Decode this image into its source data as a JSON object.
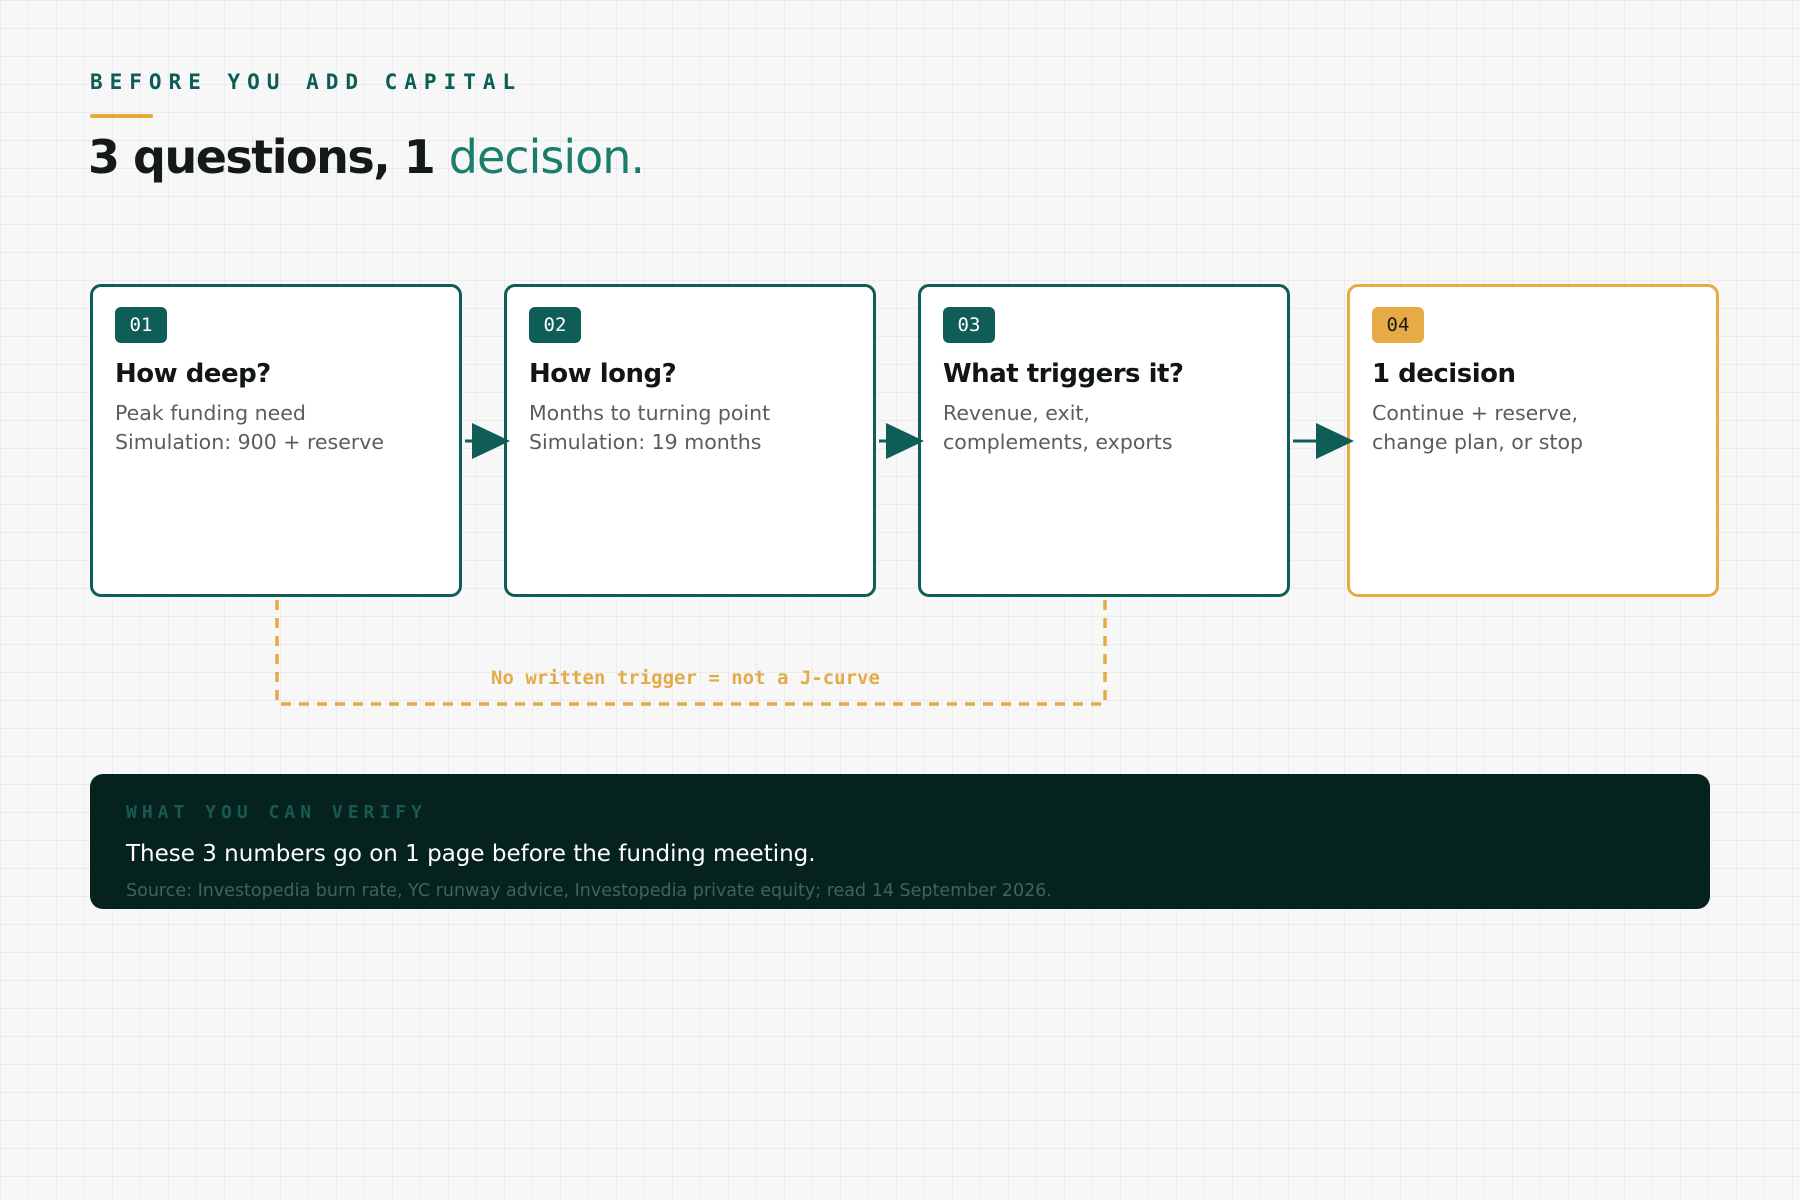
{
  "header": {
    "eyebrow": "BEFORE YOU ADD CAPITAL",
    "title_main": "3 questions, 1",
    "title_accent": "decision."
  },
  "steps": [
    {
      "badge": "01",
      "title": "How deep?",
      "lines": [
        "Peak funding need",
        "Simulation: 900 + reserve"
      ]
    },
    {
      "badge": "02",
      "title": "How long?",
      "lines": [
        "Months to turning point",
        "Simulation: 19 months"
      ]
    },
    {
      "badge": "03",
      "title": "What triggers it?",
      "lines": [
        "Revenue, exit,",
        "complements, exports"
      ]
    },
    {
      "badge": "04",
      "title": "1 decision",
      "lines": [
        "Continue + reserve,",
        "change plan, or stop"
      ]
    }
  ],
  "connector": {
    "label": "No written trigger = not a J-curve"
  },
  "panel": {
    "eyebrow": "WHAT YOU CAN VERIFY",
    "text": "These 3 numbers go on 1 page before the funding meeting.",
    "source": "Source: Investopedia burn rate, YC runway advice, Investopedia private equity; read 14 September 2026."
  },
  "colors": {
    "teal": "#0f5d57",
    "amber": "#e7ab45",
    "panel_bg": "#06221f"
  }
}
